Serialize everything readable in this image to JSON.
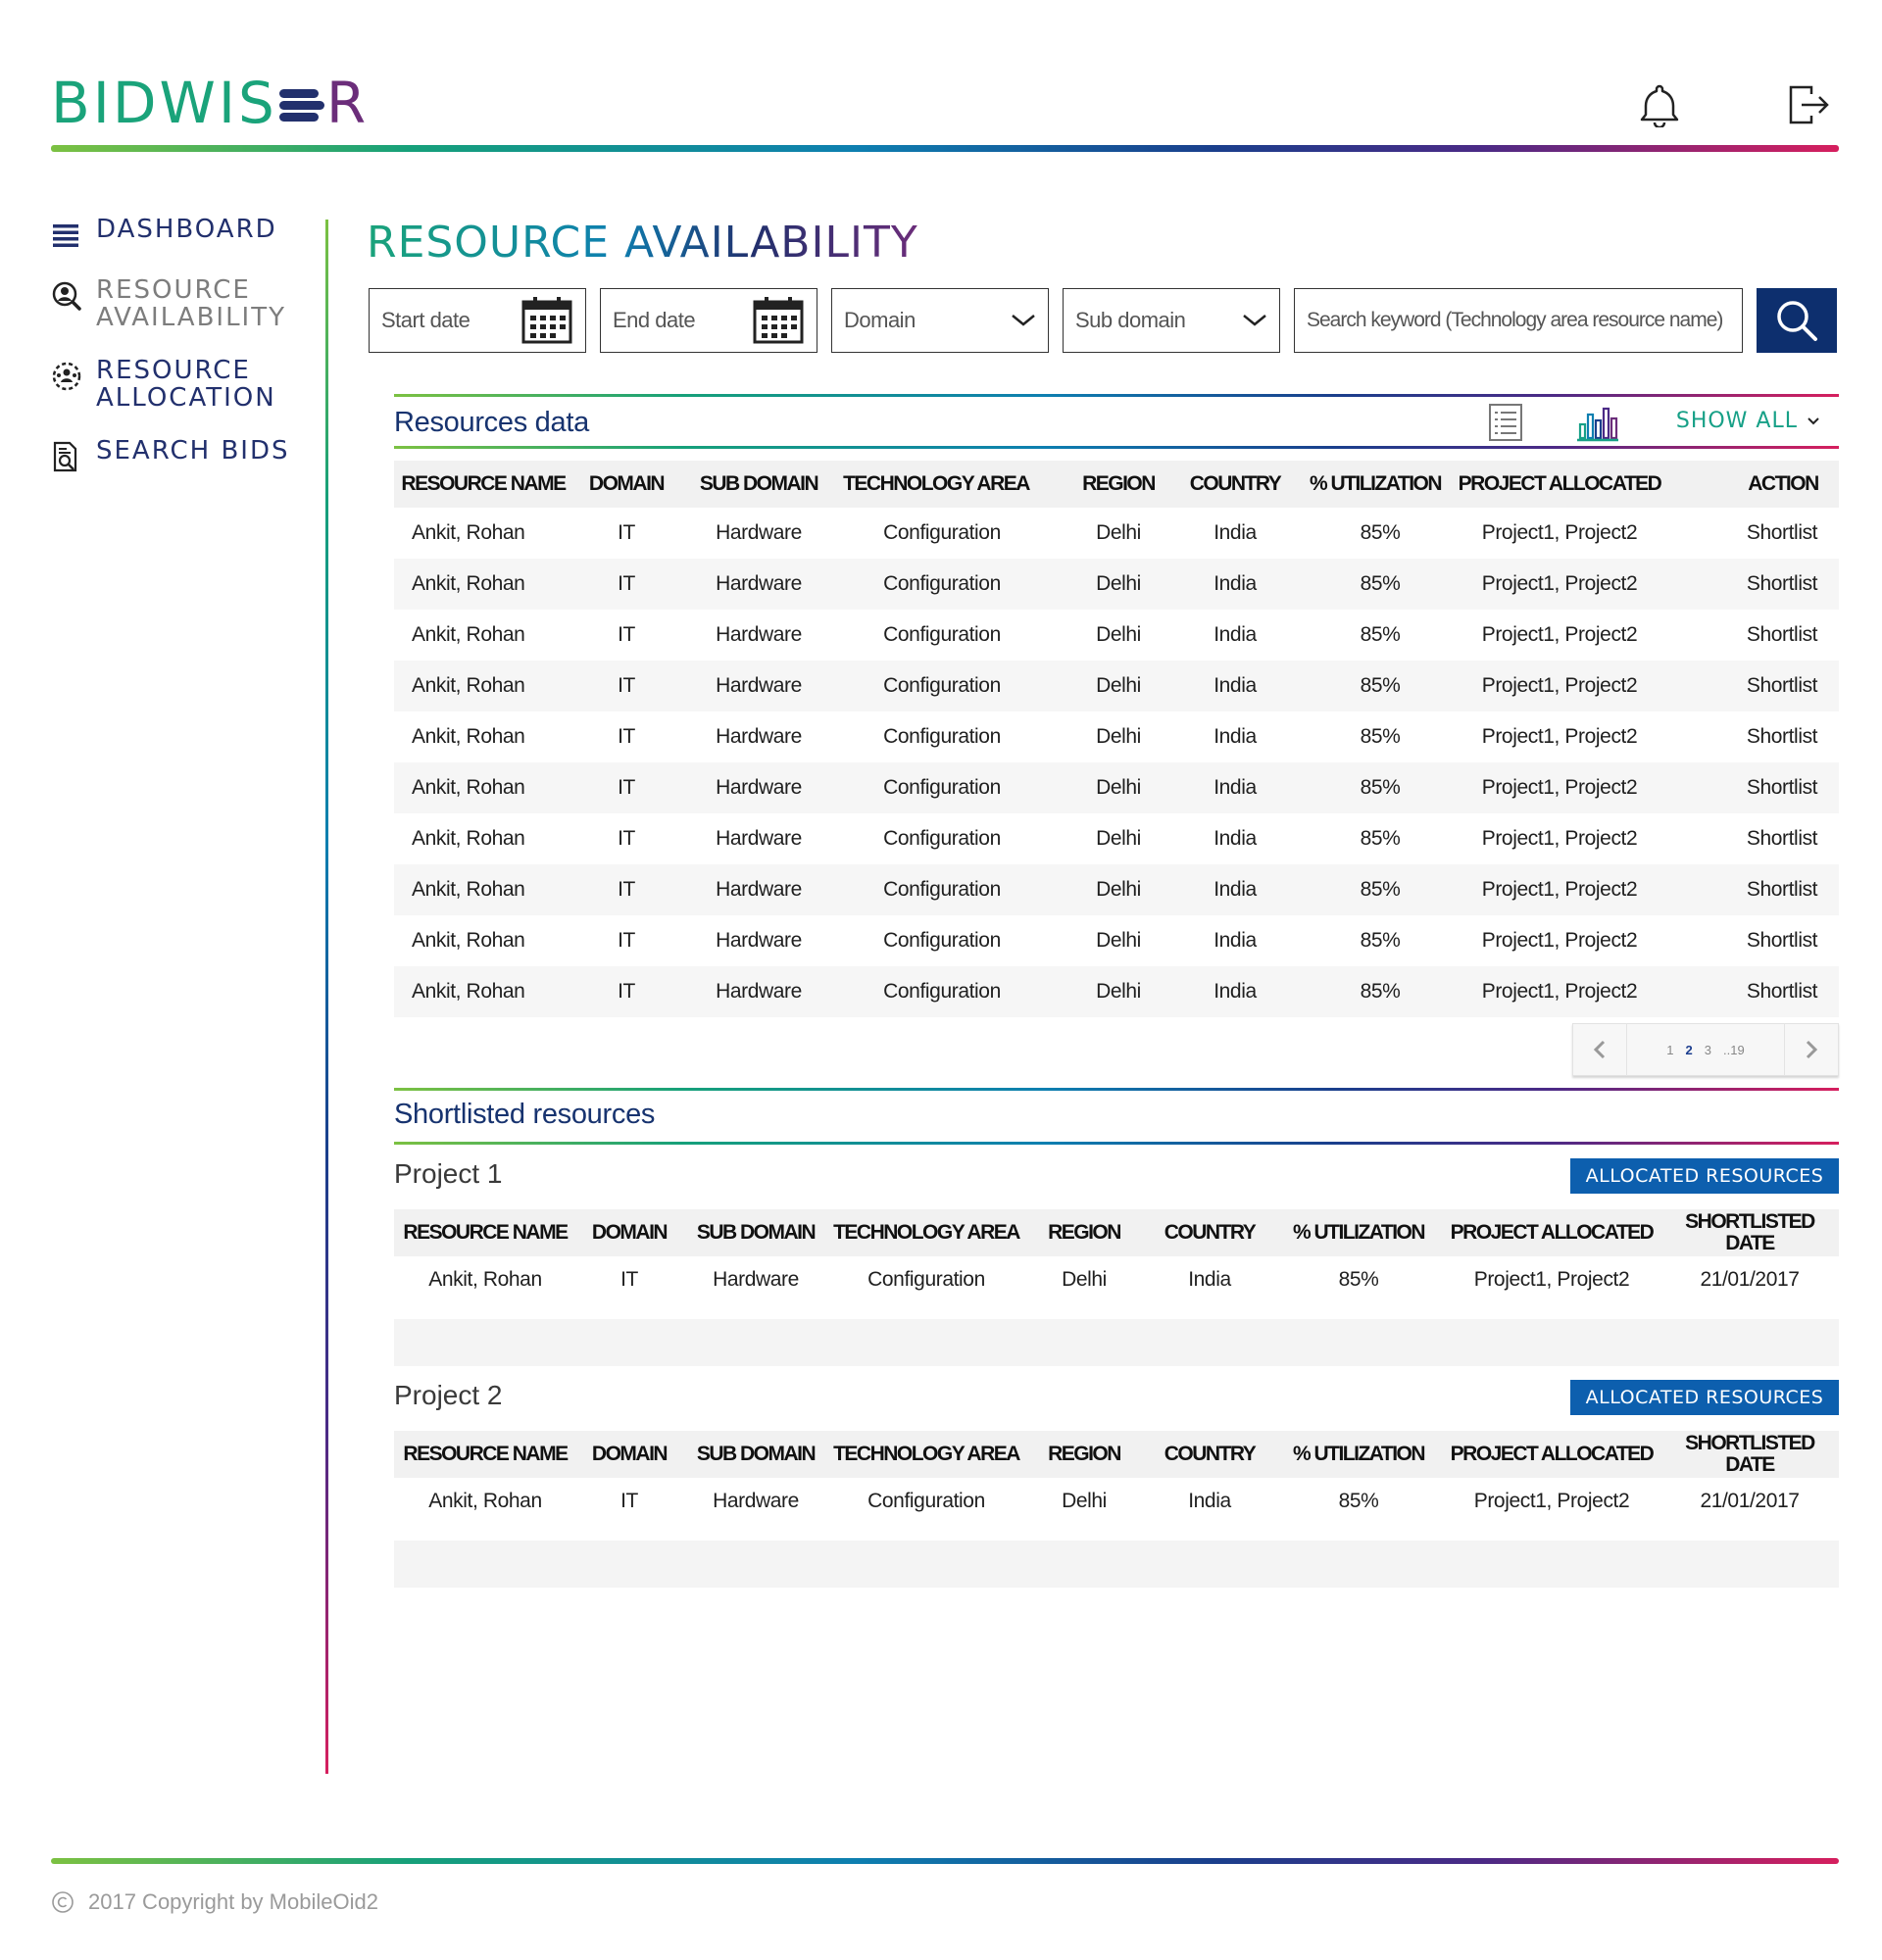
{
  "app": {
    "logo_left": "BIDWIS",
    "logo_right": "R",
    "notification_icon": "bell-icon",
    "logout_icon": "logout-icon"
  },
  "sidebar": {
    "items": [
      {
        "label": "DASHBOARD",
        "icon": "menu-list-icon"
      },
      {
        "label": "RESOURCE\nAVAILABILITY",
        "icon": "user-search-icon"
      },
      {
        "label": "RESOURCE\nALLOCATION",
        "icon": "user-group-icon"
      },
      {
        "label": "SEARCH BIDS",
        "icon": "document-search-icon"
      }
    ]
  },
  "page": {
    "title": "RESOURCE AVAILABILITY"
  },
  "filters": {
    "start_date": "Start date",
    "end_date": "End date",
    "domain": "Domain",
    "sub_domain": "Sub domain",
    "search_placeholder": "Search keyword (Technology area resource name)"
  },
  "resources": {
    "title": "Resources data",
    "show_all": "SHOW ALL",
    "headers": [
      "RESOURCE NAME",
      "DOMAIN",
      "SUB DOMAIN",
      "TECHNOLOGY AREA",
      "REGION",
      "COUNTRY",
      "% UTILIZATION",
      "PROJECT ALLOCATED",
      "ACTION"
    ],
    "rows": [
      [
        "Ankit, Rohan",
        "IT",
        "Hardware",
        "Configuration",
        "Delhi",
        "India",
        "85%",
        "Project1, Project2",
        "Shortlist"
      ],
      [
        "Ankit, Rohan",
        "IT",
        "Hardware",
        "Configuration",
        "Delhi",
        "India",
        "85%",
        "Project1, Project2",
        "Shortlist"
      ],
      [
        "Ankit, Rohan",
        "IT",
        "Hardware",
        "Configuration",
        "Delhi",
        "India",
        "85%",
        "Project1, Project2",
        "Shortlist"
      ],
      [
        "Ankit, Rohan",
        "IT",
        "Hardware",
        "Configuration",
        "Delhi",
        "India",
        "85%",
        "Project1, Project2",
        "Shortlist"
      ],
      [
        "Ankit, Rohan",
        "IT",
        "Hardware",
        "Configuration",
        "Delhi",
        "India",
        "85%",
        "Project1, Project2",
        "Shortlist"
      ],
      [
        "Ankit, Rohan",
        "IT",
        "Hardware",
        "Configuration",
        "Delhi",
        "India",
        "85%",
        "Project1, Project2",
        "Shortlist"
      ],
      [
        "Ankit, Rohan",
        "IT",
        "Hardware",
        "Configuration",
        "Delhi",
        "India",
        "85%",
        "Project1, Project2",
        "Shortlist"
      ],
      [
        "Ankit, Rohan",
        "IT",
        "Hardware",
        "Configuration",
        "Delhi",
        "India",
        "85%",
        "Project1, Project2",
        "Shortlist"
      ],
      [
        "Ankit, Rohan",
        "IT",
        "Hardware",
        "Configuration",
        "Delhi",
        "India",
        "85%",
        "Project1, Project2",
        "Shortlist"
      ],
      [
        "Ankit, Rohan",
        "IT",
        "Hardware",
        "Configuration",
        "Delhi",
        "India",
        "85%",
        "Project1, Project2",
        "Shortlist"
      ]
    ],
    "pagination": {
      "pages": [
        "1",
        "2",
        "3",
        "..19"
      ],
      "current": "2"
    }
  },
  "shortlisted": {
    "title": "Shortlisted resources",
    "allocated_label": "ALLOCATED RESOURCES",
    "headers": [
      "RESOURCE NAME",
      "DOMAIN",
      "SUB DOMAIN",
      "TECHNOLOGY AREA",
      "REGION",
      "COUNTRY",
      "% UTILIZATION",
      "PROJECT ALLOCATED",
      "SHORTLISTED DATE"
    ],
    "projects": [
      {
        "name": "Project 1",
        "rows": [
          [
            "Ankit, Rohan",
            "IT",
            "Hardware",
            "Configuration",
            "Delhi",
            "India",
            "85%",
            "Project1, Project2",
            "21/01/2017"
          ]
        ]
      },
      {
        "name": "Project 2",
        "rows": [
          [
            "Ankit, Rohan",
            "IT",
            "Hardware",
            "Configuration",
            "Delhi",
            "India",
            "85%",
            "Project1, Project2",
            "21/01/2017"
          ]
        ]
      }
    ]
  },
  "footer": {
    "copyright": "2017 Copyright by MobileOid2"
  },
  "colors": {
    "navy": "#0d2f6e",
    "teal": "#17a087",
    "button_blue": "#0d5fae"
  }
}
